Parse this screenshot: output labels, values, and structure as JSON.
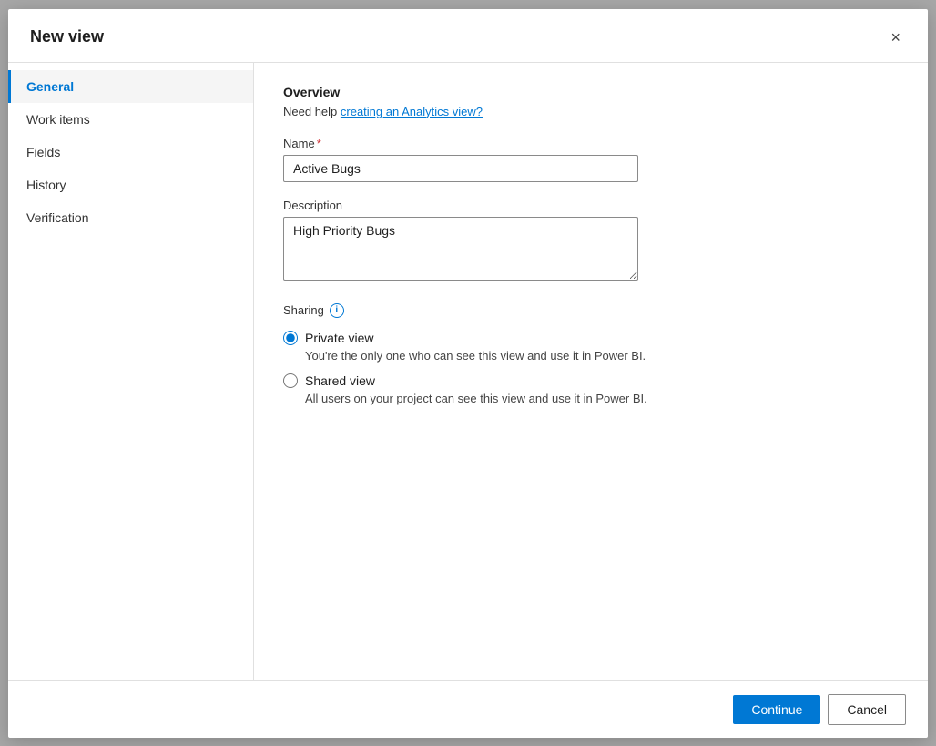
{
  "dialog": {
    "title": "New view",
    "close_label": "×"
  },
  "sidebar": {
    "items": [
      {
        "id": "general",
        "label": "General",
        "active": true
      },
      {
        "id": "work-items",
        "label": "Work items",
        "active": false
      },
      {
        "id": "fields",
        "label": "Fields",
        "active": false
      },
      {
        "id": "history",
        "label": "History",
        "active": false
      },
      {
        "id": "verification",
        "label": "Verification",
        "active": false
      }
    ]
  },
  "main": {
    "overview_title": "Overview",
    "help_text": "Need help ",
    "help_link_label": "creating an Analytics view?",
    "name_label": "Name",
    "name_required": true,
    "name_value": "Active Bugs",
    "description_label": "Description",
    "description_value": "High Priority Bugs",
    "sharing_label": "Sharing",
    "sharing_info": "i",
    "private_view_label": "Private view",
    "private_view_desc": "You're the only one who can see this view and use it in Power BI.",
    "shared_view_label": "Shared view",
    "shared_view_desc": "All users on your project can see this view and use it in Power BI."
  },
  "footer": {
    "continue_label": "Continue",
    "cancel_label": "Cancel"
  }
}
